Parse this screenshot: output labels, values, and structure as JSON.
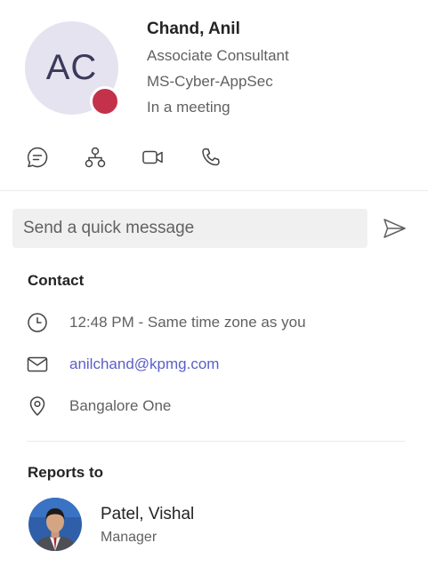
{
  "profile": {
    "initials": "AC",
    "name": "Chand, Anil",
    "title": "Associate Consultant",
    "department": "MS-Cyber-AppSec",
    "status": "In a meeting",
    "status_color": "#c4314b"
  },
  "actions": [
    {
      "icon": "chat-icon"
    },
    {
      "icon": "org-chart-icon"
    },
    {
      "icon": "video-call-icon"
    },
    {
      "icon": "audio-call-icon"
    }
  ],
  "quick_message": {
    "placeholder": "Send a quick message",
    "send_icon": "send-icon"
  },
  "contact": {
    "heading": "Contact",
    "local_time": "12:48 PM - Same time zone as you",
    "email": "anilchand@kpmg.com",
    "location": "Bangalore One"
  },
  "reports_to": {
    "heading": "Reports to",
    "name": "Patel, Vishal",
    "title": "Manager"
  },
  "colors": {
    "accent": "#5b5fc7",
    "avatar_bg": "#e6e3f1",
    "input_bg": "#f0f0f0"
  }
}
